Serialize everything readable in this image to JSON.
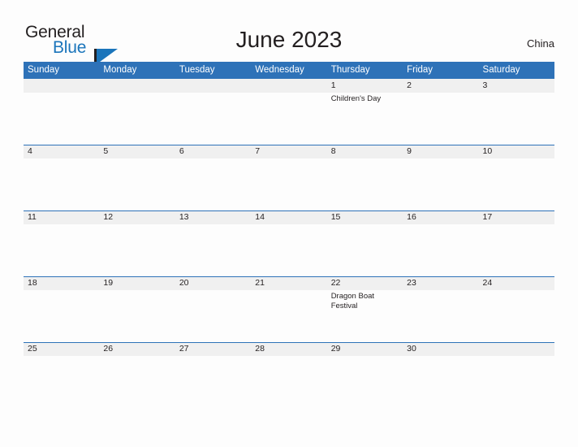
{
  "brand": {
    "name_part1": "General",
    "name_part2": "Blue",
    "accent_color": "#1b75bb"
  },
  "header": {
    "title": "June 2023",
    "country": "China",
    "header_bg_color": "#2e72b8",
    "band_bg_color": "#f0f0f0"
  },
  "weekdays": [
    {
      "label": "Sunday"
    },
    {
      "label": "Monday"
    },
    {
      "label": "Tuesday"
    },
    {
      "label": "Wednesday"
    },
    {
      "label": "Thursday"
    },
    {
      "label": "Friday"
    },
    {
      "label": "Saturday"
    }
  ],
  "weeks": [
    {
      "days": [
        {
          "number": "",
          "events": []
        },
        {
          "number": "",
          "events": []
        },
        {
          "number": "",
          "events": []
        },
        {
          "number": "",
          "events": []
        },
        {
          "number": "1",
          "events": [
            {
              "name": "Children's Day"
            }
          ]
        },
        {
          "number": "2",
          "events": []
        },
        {
          "number": "3",
          "events": []
        }
      ]
    },
    {
      "days": [
        {
          "number": "4",
          "events": []
        },
        {
          "number": "5",
          "events": []
        },
        {
          "number": "6",
          "events": []
        },
        {
          "number": "7",
          "events": []
        },
        {
          "number": "8",
          "events": []
        },
        {
          "number": "9",
          "events": []
        },
        {
          "number": "10",
          "events": []
        }
      ]
    },
    {
      "days": [
        {
          "number": "11",
          "events": []
        },
        {
          "number": "12",
          "events": []
        },
        {
          "number": "13",
          "events": []
        },
        {
          "number": "14",
          "events": []
        },
        {
          "number": "15",
          "events": []
        },
        {
          "number": "16",
          "events": []
        },
        {
          "number": "17",
          "events": []
        }
      ]
    },
    {
      "days": [
        {
          "number": "18",
          "events": []
        },
        {
          "number": "19",
          "events": []
        },
        {
          "number": "20",
          "events": []
        },
        {
          "number": "21",
          "events": []
        },
        {
          "number": "22",
          "events": [
            {
              "name": "Dragon Boat Festival"
            }
          ]
        },
        {
          "number": "23",
          "events": []
        },
        {
          "number": "24",
          "events": []
        }
      ]
    },
    {
      "days": [
        {
          "number": "25",
          "events": []
        },
        {
          "number": "26",
          "events": []
        },
        {
          "number": "27",
          "events": []
        },
        {
          "number": "28",
          "events": []
        },
        {
          "number": "29",
          "events": []
        },
        {
          "number": "30",
          "events": []
        },
        {
          "number": "",
          "events": []
        }
      ]
    }
  ]
}
